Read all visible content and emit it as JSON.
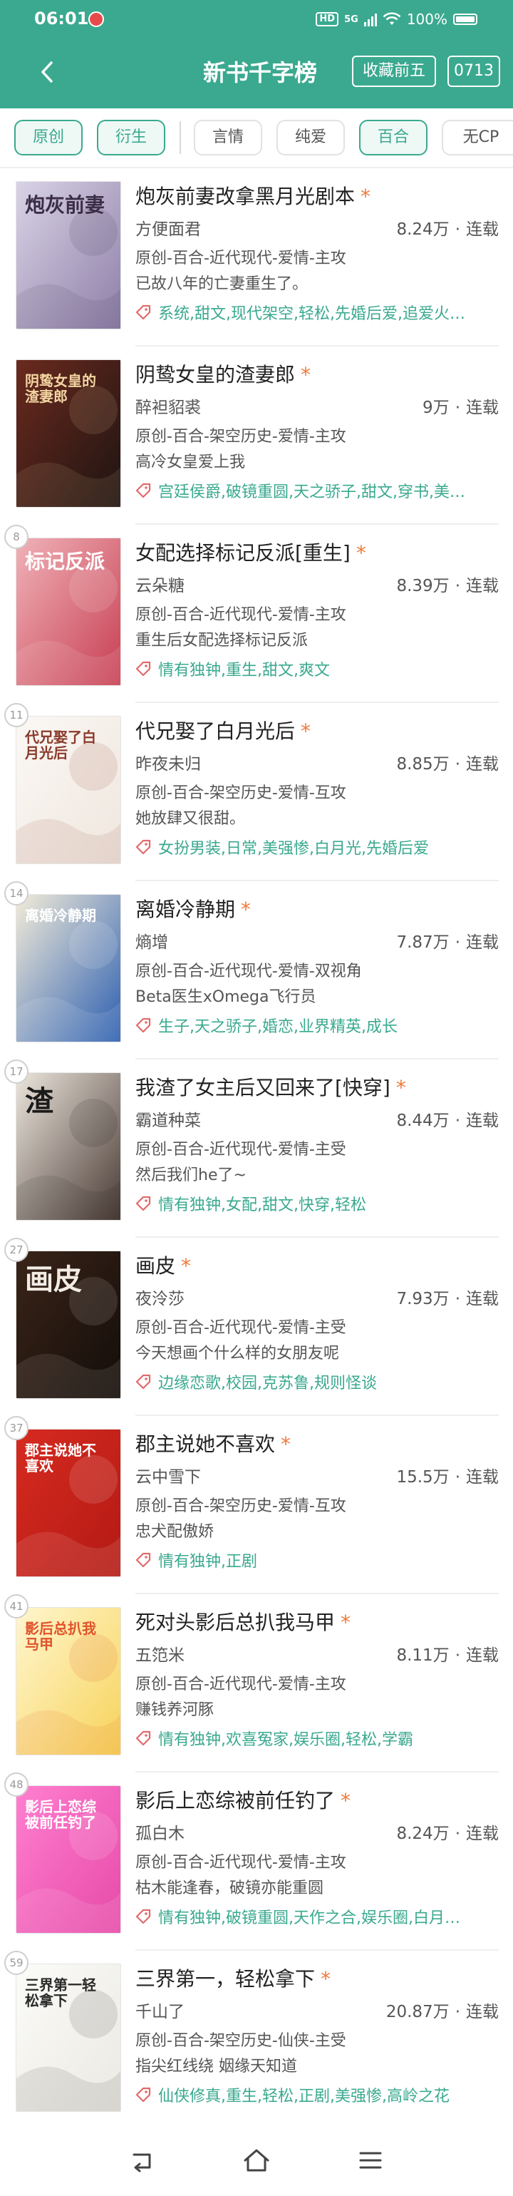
{
  "status": {
    "time": "06:01",
    "battery": "100%",
    "network_badge": "HD",
    "network_gen": "5G"
  },
  "header": {
    "title": "新书千字榜",
    "favorite_button": "收藏前五",
    "date_button": "0713"
  },
  "filters": [
    {
      "label": "原创",
      "active": true
    },
    {
      "label": "衍生",
      "active": true
    },
    {
      "label": "言情",
      "active": false
    },
    {
      "label": "纯爱",
      "active": false
    },
    {
      "label": "百合",
      "active": true
    },
    {
      "label": "无CP",
      "active": false
    }
  ],
  "colors": {
    "accent": "#3aa98f",
    "star": "#f07a3a"
  },
  "books": [
    {
      "rank": "",
      "title": "炮灰前妻改拿黑月光剧本",
      "star": "*",
      "author": "方便面君",
      "words": "8.24万",
      "status": "连载",
      "genre": "原创-百合-近代现代-爱情-主攻",
      "desc": "已故八年的亡妻重生了。",
      "tags": "系统,甜文,现代架空,轻松,先婚后爱,追爱火…",
      "cover": {
        "text": "炮灰前妻",
        "bg1": "#d9d3e6",
        "bg2": "#8e7fa8",
        "fg": "#3a2f46"
      }
    },
    {
      "rank": "",
      "title": "阴鸷女皇的渣妻郎",
      "star": "*",
      "author": "醉袒貂裘",
      "words": "9万",
      "status": "连载",
      "genre": "原创-百合-架空历史-爱情-主攻",
      "desc": "高冷女皇爱上我",
      "tags": "宫廷侯爵,破镜重圆,天之骄子,甜文,穿书,美…",
      "cover": {
        "text": "阴鸷女皇的渣妻郎",
        "bg1": "#6a2a1e",
        "bg2": "#1e1412",
        "fg": "#f3d5a2"
      }
    },
    {
      "rank": "8",
      "title": "女配选择标记反派[重生]",
      "star": "*",
      "author": "云朵糖",
      "words": "8.39万",
      "status": "连载",
      "genre": "原创-百合-近代现代-爱情-主攻",
      "desc": "重生后女配选择标记反派",
      "tags": "情有独钟,重生,甜文,爽文",
      "cover": {
        "text": "标记反派",
        "bg1": "#f0b2b8",
        "bg2": "#c73f52",
        "fg": "#ffffff"
      }
    },
    {
      "rank": "11",
      "title": "代兄娶了白月光后",
      "star": "*",
      "author": "昨夜未归",
      "words": "8.85万",
      "status": "连载",
      "genre": "原创-百合-架空历史-爱情-互攻",
      "desc": "她放肆又很甜。",
      "tags": "女扮男装,日常,美强惨,白月光,先婚后爱",
      "cover": {
        "text": "代兄娶了白月光后",
        "bg1": "#fbf8f4",
        "bg2": "#efe6de",
        "fg": "#8a3a2a"
      }
    },
    {
      "rank": "14",
      "title": "离婚冷静期",
      "star": "*",
      "author": "熵增",
      "words": "7.87万",
      "status": "连载",
      "genre": "原创-百合-近代现代-爱情-双视角",
      "desc": "Beta医生xOmega飞行员",
      "tags": "生子,天之骄子,婚恋,业界精英,成长",
      "cover": {
        "text": "离婚冷静期",
        "bg1": "#f3ecd9",
        "bg2": "#2d5fb0",
        "fg": "#ffffff"
      }
    },
    {
      "rank": "17",
      "title": "我渣了女主后又回来了[快穿]",
      "star": "*",
      "author": "霸道种菜",
      "words": "8.44万",
      "status": "连载",
      "genre": "原创-百合-近代现代-爱情-主受",
      "desc": "然后我们he了~",
      "tags": "情有独钟,女配,甜文,快穿,轻松",
      "cover": {
        "text": "渣",
        "bg1": "#ece6dd",
        "bg2": "#4a3b35",
        "fg": "#1b1b1b"
      }
    },
    {
      "rank": "27",
      "title": "画皮",
      "star": "*",
      "author": "夜泠莎",
      "words": "7.93万",
      "status": "连载",
      "genre": "原创-百合-近代现代-爱情-主受",
      "desc": "今天想画个什么样的女朋友呢",
      "tags": "边缘恋歌,校园,克苏鲁,规则怪谈",
      "cover": {
        "text": "画皮",
        "bg1": "#3a2418",
        "bg2": "#130d0a",
        "fg": "#f2ece4"
      }
    },
    {
      "rank": "37",
      "title": "郡主说她不喜欢",
      "star": "*",
      "author": "云中雪下",
      "words": "15.5万",
      "status": "连载",
      "genre": "原创-百合-架空历史-爱情-互攻",
      "desc": "忠犬配傲娇",
      "tags": "情有独钟,正剧",
      "cover": {
        "text": "郡主说她不喜欢",
        "bg1": "#d62a20",
        "bg2": "#b31a14",
        "fg": "#ffffff"
      }
    },
    {
      "rank": "41",
      "title": "死对头影后总扒我马甲",
      "star": "*",
      "author": "五笵米",
      "words": "8.11万",
      "status": "连载",
      "genre": "原创-百合-近代现代-爱情-主攻",
      "desc": "赚钱养河豚",
      "tags": "情有独钟,欢喜冤家,娱乐圈,轻松,学霸",
      "cover": {
        "text": "影后总扒我马甲",
        "bg1": "#fff6cf",
        "bg2": "#f7d35a",
        "fg": "#e0532b"
      }
    },
    {
      "rank": "48",
      "title": "影后上恋综被前任钓了",
      "star": "*",
      "author": "孤白木",
      "words": "8.24万",
      "status": "连载",
      "genre": "原创-百合-近代现代-爱情-主攻",
      "desc": "枯木能逢春，破镜亦能重圆",
      "tags": "情有独钟,破镜重圆,天作之合,娱乐圈,白月…",
      "cover": {
        "text": "影后上恋综被前任钓了",
        "bg1": "#ff7fd0",
        "bg2": "#e64aa8",
        "fg": "#ffffff"
      }
    },
    {
      "rank": "59",
      "title": "三界第一，轻松拿下",
      "star": "*",
      "author": "千山了",
      "words": "20.87万",
      "status": "连载",
      "genre": "原创-百合-架空历史-仙侠-主受",
      "desc": "指尖红线绕 姻缘天知道",
      "tags": "仙侠修真,重生,轻松,正剧,美强惨,高岭之花",
      "cover": {
        "text": "三界第一轻松拿下",
        "bg1": "#fbfbf8",
        "bg2": "#ebe9e2",
        "fg": "#2a2a2a"
      }
    }
  ]
}
